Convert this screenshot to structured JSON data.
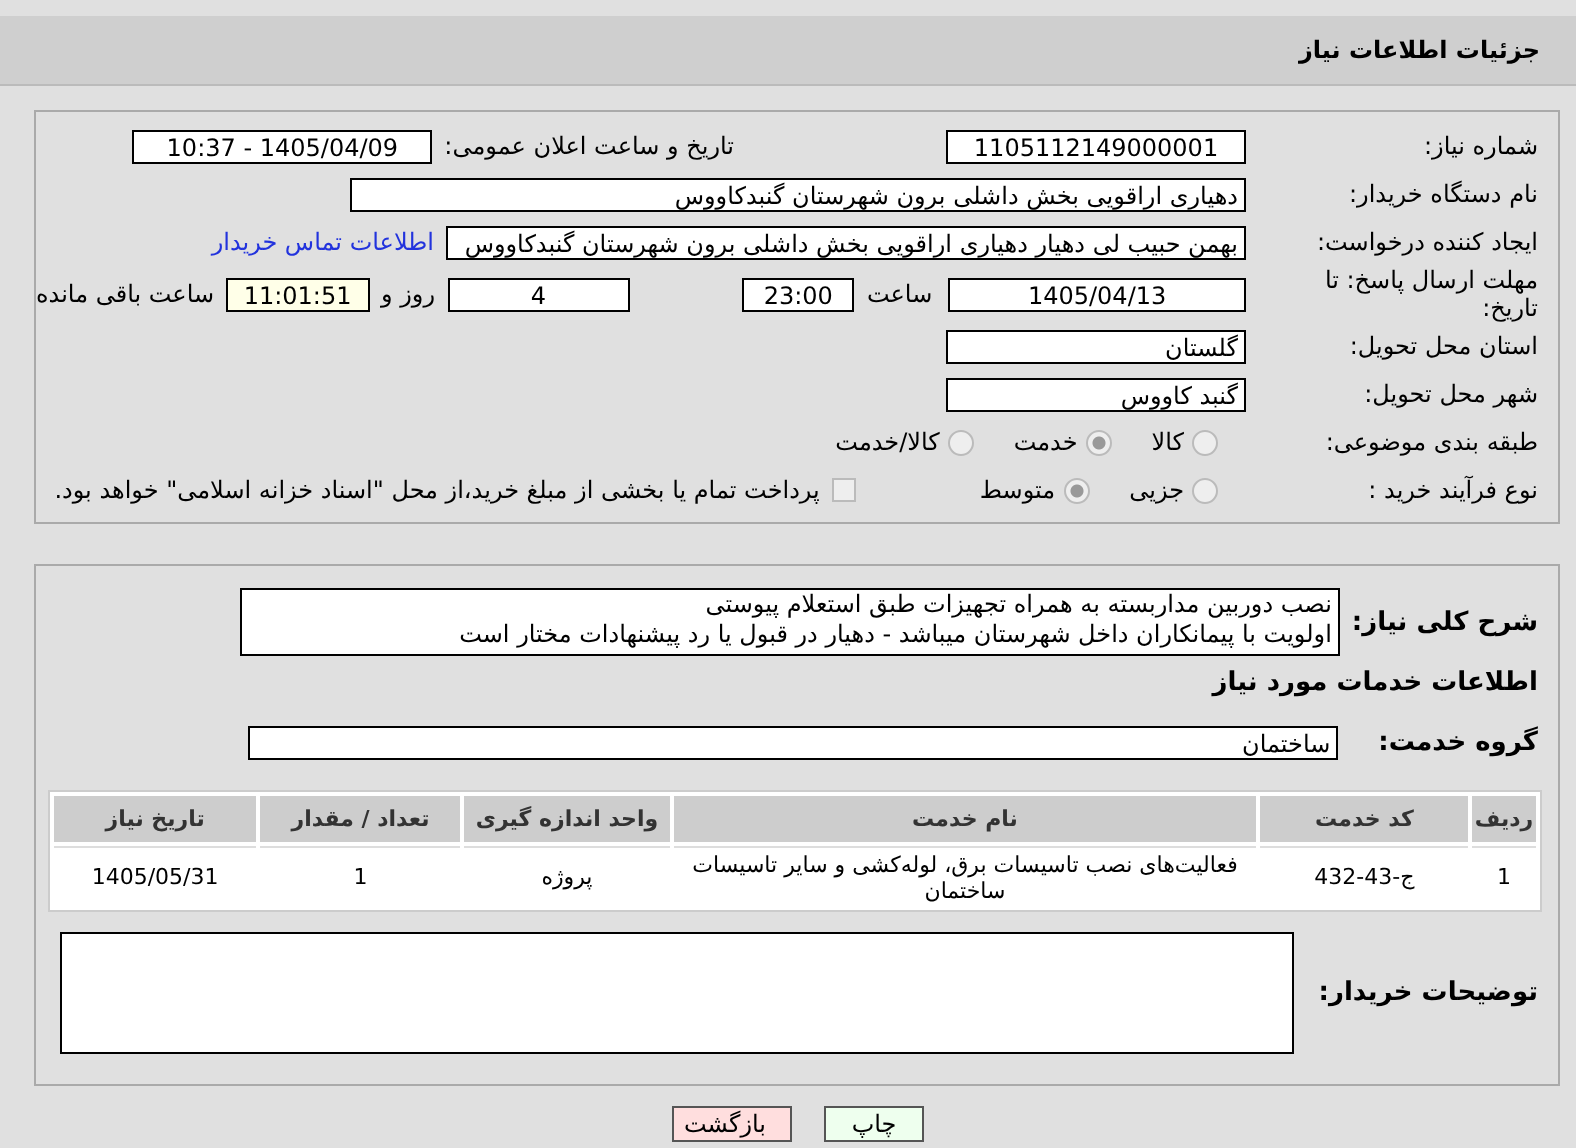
{
  "header": {
    "title": "جزئیات اطلاعات نیاز"
  },
  "need_number": {
    "label": "شماره نیاز:",
    "value": "1105112149000001"
  },
  "announce": {
    "label": "تاریخ و ساعت اعلان عمومی:",
    "value": "1405/04/09 - 10:37"
  },
  "buyer": {
    "label": "نام دستگاه خریدار:",
    "value": "دهیاری اراقویی بخش داشلی برون شهرستان گنبدکاووس"
  },
  "requester": {
    "label": "ایجاد کننده درخواست:",
    "value": "بهمن حبیب لی دهیار دهیاری اراقویی بخش داشلی برون شهرستان گنبدکاووس",
    "link": "اطلاعات تماس خریدار"
  },
  "deadline": {
    "label": "مهلت ارسال پاسخ: تا تاریخ:",
    "date": "1405/04/13",
    "time_label": "ساعت",
    "time": "23:00",
    "days": "4",
    "days_label": "روز و",
    "remaining": "11:01:51",
    "remaining_label": "ساعت باقی مانده"
  },
  "province": {
    "label": "استان محل تحویل:",
    "value": "گلستان"
  },
  "city": {
    "label": "شهر محل تحویل:",
    "value": "گنبد کاووس"
  },
  "category": {
    "label": "طبقه بندی موضوعی:",
    "options": [
      {
        "label": "کالا",
        "selected": false
      },
      {
        "label": "خدمت",
        "selected": true
      },
      {
        "label": "کالا/خدمت",
        "selected": false
      }
    ]
  },
  "process": {
    "label": "نوع فرآیند خرید :",
    "options": [
      {
        "label": "جزیی",
        "selected": false
      },
      {
        "label": "متوسط",
        "selected": true
      }
    ],
    "payment": {
      "label": "پرداخت تمام یا بخشی از مبلغ خرید،از محل \"اسناد خزانه اسلامی\" خواهد بود.",
      "checked": false
    }
  },
  "description": {
    "label": "شرح کلی نیاز:",
    "lines": [
      "نصب دوربین مداربسته به همراه تجهیزات  طبق استعلام پیوستی",
      "اولویت با پیمانکاران داخل شهرستان میباشد - دهیار در قبول یا رد پیشنهادات مختار است"
    ]
  },
  "services_title": "اطلاعات خدمات مورد نیاز",
  "service_group": {
    "label": "گروه خدمت:",
    "value": "ساختمان"
  },
  "table": {
    "columns": [
      "ردیف",
      "کد خدمت",
      "نام خدمت",
      "واحد اندازه گیری",
      "تعداد / مقدار",
      "تاریخ نیاز"
    ],
    "rows": [
      [
        "1",
        "ج-43-432",
        "فعالیت‌های نصب تاسیسات برق، لوله‌کشی و سایر تاسیسات ساختمان",
        "پروژه",
        "1",
        "1405/05/31"
      ]
    ]
  },
  "buyer_notes": {
    "label": "توضیحات خریدار:"
  },
  "buttons": [
    {
      "label": "چاپ",
      "kind": "print"
    },
    {
      "label": "بازگشت",
      "kind": "back"
    }
  ]
}
